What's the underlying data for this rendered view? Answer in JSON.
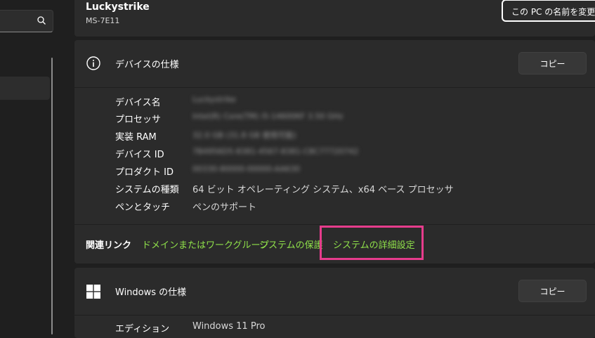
{
  "search": {
    "placeholder": ""
  },
  "pc": {
    "name": "Luckystrike",
    "model": "MS-7E11",
    "rename_label": "この PC の名前を変更"
  },
  "device_spec": {
    "title": "デバイスの仕様",
    "copy_label": "コピー",
    "rows": [
      {
        "label": "デバイス名",
        "value": "Luckystrike",
        "blurred": true
      },
      {
        "label": "プロセッサ",
        "value": "Intel(R) Core(TM) i5-14600KF   3.50 GHz",
        "blurred": true
      },
      {
        "label": "実装 RAM",
        "value": "32.0 GB (31.8 GB 使用可能)",
        "blurred": true
      },
      {
        "label": "デバイス ID",
        "value": "7B4956D5-8381-4567-8381-C8C77720742",
        "blurred": true
      },
      {
        "label": "プロダクト ID",
        "value": "00330-80000-00000-AA630",
        "blurred": true
      },
      {
        "label": "システムの種類",
        "value": "64 ビット オペレーティング システム、x64 ベース プロセッサ",
        "blurred": false
      },
      {
        "label": "ペンとタッチ",
        "value": "ペンのサポート",
        "blurred": false
      }
    ]
  },
  "related": {
    "label": "関連リンク",
    "links": [
      "ドメインまたはワークグループ",
      "システムの保護",
      "システムの詳細設定"
    ]
  },
  "windows_spec": {
    "title": "Windows の仕様",
    "copy_label": "コピー",
    "rows": [
      {
        "label": "エディション",
        "value": "Windows 11 Pro"
      }
    ]
  },
  "colors": {
    "link": "#8fe04a",
    "highlight": "#e63c8c",
    "card": "#2b2b2b",
    "background": "#1f1f1f"
  },
  "icons": [
    "search-icon",
    "info-icon",
    "windows-logo-icon"
  ]
}
